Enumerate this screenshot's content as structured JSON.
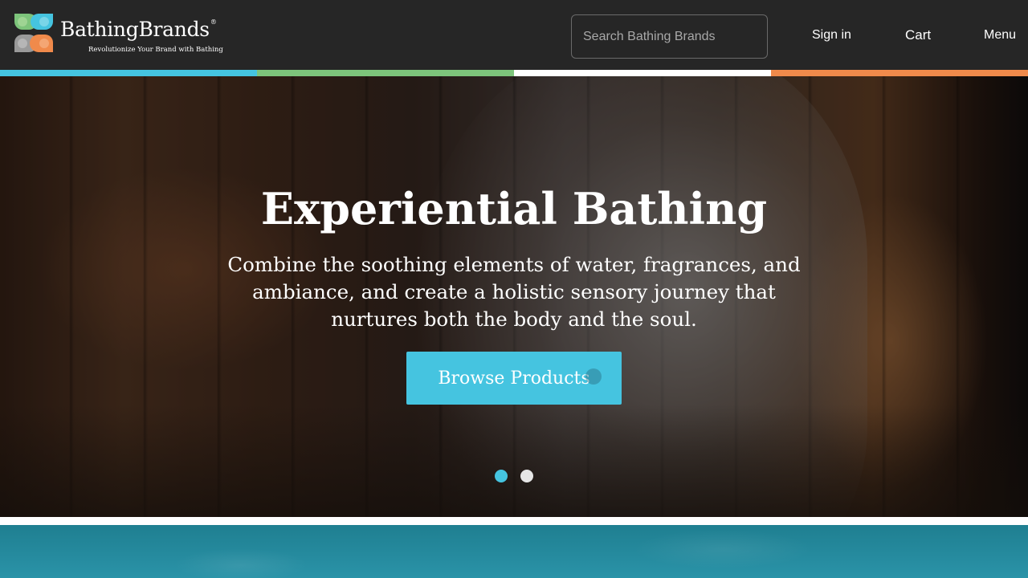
{
  "header": {
    "logo": {
      "brand_part1": "Bathing",
      "brand_part2": "Brands",
      "registered": "®",
      "tagline": "Revolutionize Your Brand with Bathing",
      "colors": [
        "#7dc47b",
        "#45c4e0",
        "#9a9a9a",
        "#f08a4b"
      ]
    },
    "search": {
      "placeholder": "Search Bathing Brands",
      "value": ""
    },
    "nav": {
      "sign_in": "Sign in",
      "cart": "Cart",
      "menu": "Menu"
    }
  },
  "stripe_colors": [
    "#45c4e0",
    "#7dc47b",
    "#ffffff",
    "#f08a4b"
  ],
  "hero": {
    "title": "Experiential Bathing",
    "text": "Combine the soothing elements of water, fragrances, and ambiance, and create a holistic sensory journey that nurtures both the body and the soul.",
    "cta_label": "Browse Products",
    "slides_total": 2,
    "active_slide": 1
  },
  "theme": {
    "header_bg": "#262626",
    "accent": "#45c4e0"
  }
}
